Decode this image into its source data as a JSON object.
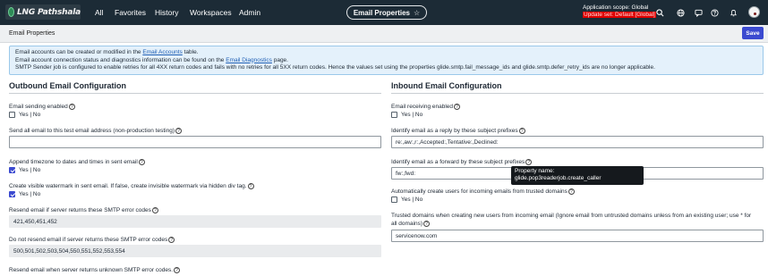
{
  "brand": {
    "logo_text": "LNG Pathshala"
  },
  "nav": {
    "items": [
      "All",
      "Favorites",
      "History",
      "Workspaces",
      "Admin"
    ],
    "page_title": "Email Properties",
    "scope_line1": "Application scope: Global",
    "scope_line2": "Update set: Default [Global]",
    "icons": [
      "search-icon",
      "globe-icon",
      "chat-icon",
      "help-icon",
      "bell-icon",
      "user-avatar"
    ]
  },
  "form": {
    "title": "Email Properties",
    "save_label": "Save"
  },
  "info": {
    "line1_pre": "Email accounts can be created or modified in the ",
    "line1_link": "Email Accounts",
    "line1_post": " table.",
    "line2_pre": "Email account connection status and diagnostics information can be found on the ",
    "line2_link": "Email Diagnostics",
    "line2_post": " page.",
    "line3": "SMTP Sender job is configured to enable retries for all 4XX return codes and fails with no retries for all 5XX return codes. Hence the values set using the properties glide.smtp.fail_message_ids and glide.smtp.defer_retry_ids are no longer applicable."
  },
  "outbound": {
    "title": "Outbound Email Configuration",
    "sending_label": "Email sending enabled",
    "sending_value": "Yes | No",
    "sending_checked": false,
    "test_email_label": "Send all email to this test email address (non-production testing)",
    "test_email_value": "",
    "timezone_label": "Append timezone to dates and times in sent email",
    "timezone_value": "Yes | No",
    "timezone_checked": true,
    "watermark_label": "Create visible watermark in sent email. If false, create invisible watermark via hidden div tag.",
    "watermark_value": "Yes | No",
    "watermark_checked": true,
    "resend_label": "Resend email if server returns these SMTP error codes",
    "resend_value": "421,450,451,452",
    "noresend_label": "Do not resend email if server returns these SMTP error codes",
    "noresend_value": "500,501,502,503,504,550,551,552,553,554",
    "unknown_label": "Resend email when server returns unknown SMTP error codes."
  },
  "inbound": {
    "title": "Inbound Email Configuration",
    "receiving_label": "Email receiving enabled",
    "receiving_value": "Yes | No",
    "receiving_checked": false,
    "reply_label": "Identify email as a reply by these subject prefixes",
    "reply_value": "re:,aw:,r:,Accepted:,Tentative:,Declined:",
    "forward_label": "Identify email as a forward by these subject prefixes",
    "forward_value": "fw:,fwd:",
    "autocreate_label": "Automatically create users for incoming emails from trusted domains",
    "autocreate_value": "Yes | No",
    "autocreate_checked": false,
    "trusted_label_1": "Trusted domains when creating new users from incoming email (Ignore email from untrusted domains unless from an existing user; use * for",
    "trusted_label_2": "all domains)",
    "trusted_value": "servicenow.com"
  },
  "tooltip": {
    "line1": "Property name:",
    "line2": "glide.pop3readerjob.create_caller"
  },
  "colors": {
    "nav_bg": "#1c2b36",
    "accent": "#3b4ad0",
    "info_bg": "#e4f1fb",
    "update_set_red": "#e00000"
  }
}
